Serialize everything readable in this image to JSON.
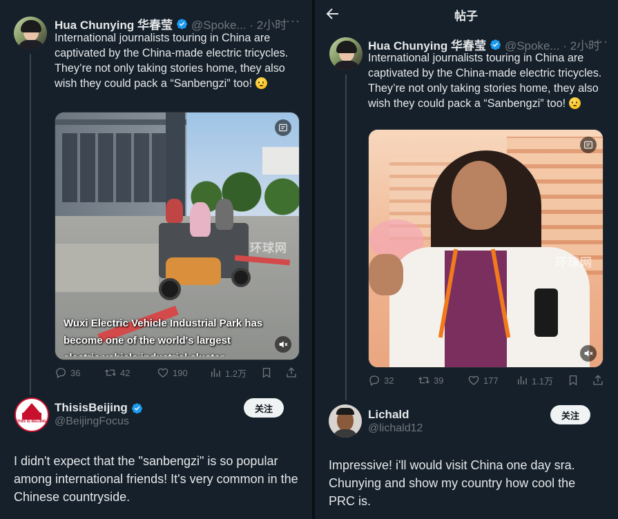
{
  "left": {
    "tweet": {
      "author_name": "Hua Chunying 华春莹",
      "handle_time": "@Spoke... · 2小时",
      "text": "International journalists touring in China are captivated by the China-made electric tricycles. They’re not only taking stories home, they also wish they could pack a “Sanbengzi” too!",
      "caption": "Wuxi Electric Vehicle Industrial Park has become one of the world's largest electric vehicle industrial cluster",
      "watermark": "环球网",
      "stats": {
        "replies": "36",
        "retweets": "42",
        "likes": "190",
        "views": "1.2万"
      }
    },
    "reply": {
      "author_name": "ThisisBeijing",
      "handle": "@BeijingFocus",
      "avatar_text": "THIS IS BEIJING",
      "follow_label": "关注",
      "text": "I didn't expect that the \"sanbengzi\" is so popular among international friends! It's very common in the Chinese countryside."
    }
  },
  "right": {
    "header": {
      "title": "帖子"
    },
    "tweet": {
      "author_name": "Hua Chunying 华春莹",
      "handle_time": "@Spoke... · 2小时",
      "text": "International journalists touring in China are captivated by the China-made electric tricycles. They’re not only taking stories home, they also wish they could pack a “Sanbengzi” too!",
      "watermark": "环球网",
      "stats": {
        "replies": "32",
        "retweets": "39",
        "likes": "177",
        "views": "1.1万"
      }
    },
    "reply": {
      "author_name": "Lichald",
      "handle": "@lichald12",
      "follow_label": "关注",
      "text": "Impressive! i'll would visit China one day sra. Chunying and show my country how cool the PRC is."
    }
  },
  "colors": {
    "background": "#15202b",
    "verified": "#1d9bf0",
    "muted": "#71767b",
    "text": "#e7e9ea"
  }
}
